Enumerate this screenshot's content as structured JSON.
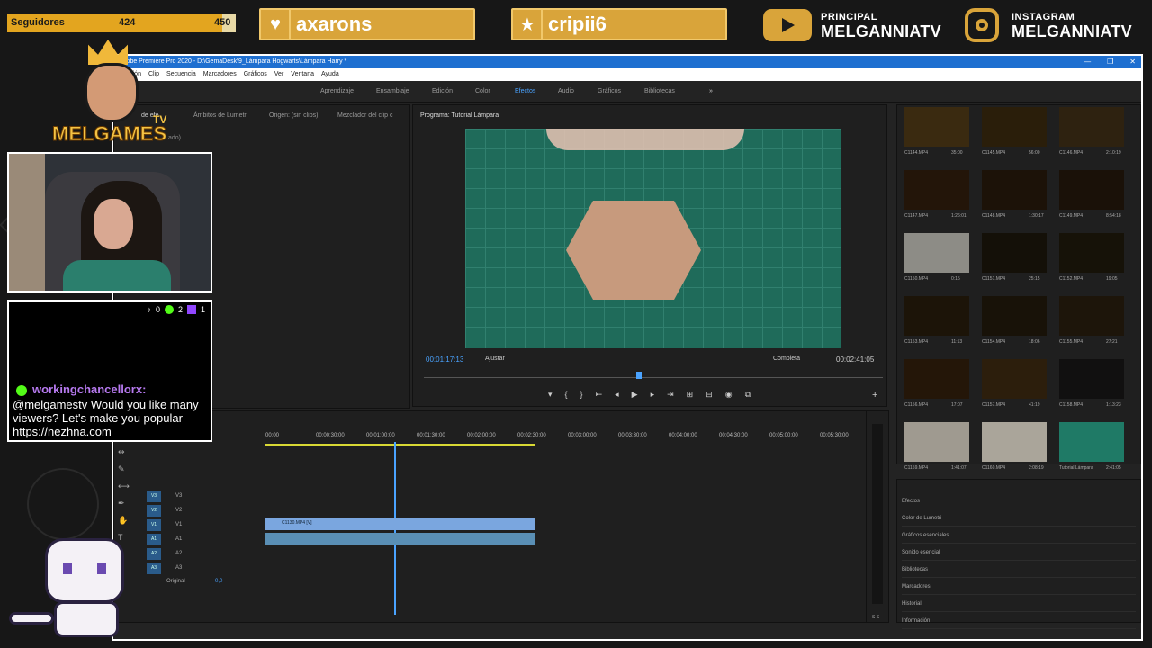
{
  "overlay": {
    "followers_label": "Seguidores",
    "followers_current": "424",
    "followers_goal": "450",
    "followers_progress": 0.942,
    "pill1": "axarons",
    "pill2": "cripii6",
    "youtube_label": "PRINCIPAL",
    "youtube_name": "MELGANNIATV",
    "instagram_label": "INSTAGRAM",
    "instagram_name": "MELGANNIATV",
    "logo_text": "MELGAMES",
    "logo_suffix": "TV"
  },
  "premiere": {
    "title": "Adobe Premiere Pro 2020 - D:\\GemaDesk\\9_Lámpara Hogwarts\\Lámpara Harry *",
    "menu": [
      "Edición",
      "Clip",
      "Secuencia",
      "Marcadores",
      "Gráficos",
      "Ver",
      "Ventana",
      "Ayuda"
    ],
    "workspaces": [
      "Aprendizaje",
      "Ensamblaje",
      "Edición",
      "Color",
      "Efectos",
      "Audio",
      "Gráficos",
      "Bibliotecas"
    ],
    "active_workspace": "Efectos",
    "source_tabs": [
      "Ámbitos de Lumetri",
      "Origen: (sin clips)",
      "Mezclador del clip c"
    ],
    "source_fragment_1": "de efe",
    "source_fragment_2": "ado)",
    "program_title": "Programa: Tutorial Lámpara",
    "timecode_current": "00:01:17:13",
    "fit": "Ajustar",
    "quality": "Completa",
    "timecode_total": "00:02:41:05",
    "ruler": [
      "00:00",
      "00:00:30:00",
      "00:01:00:00",
      "00:01:30:00",
      "00:02:00:00",
      "00:02:30:00",
      "00:03:00:00",
      "00:03:30:00",
      "00:04:00:00",
      "00:04:30:00",
      "00:05:00:00",
      "00:05:30:00"
    ],
    "tracks": [
      {
        "tag": "V3",
        "name": "V3"
      },
      {
        "tag": "V2",
        "name": "V2"
      },
      {
        "tag": "V1",
        "name": "V1"
      },
      {
        "tag": "A1",
        "name": "A1"
      },
      {
        "tag": "A2",
        "name": "A2"
      },
      {
        "tag": "A3",
        "name": "A3"
      }
    ],
    "clip_label": "C1130.MP4 [V]",
    "original_label": "Original",
    "original_value": "0,0",
    "meter_label": "S S",
    "clips": [
      {
        "name": "C1144.MP4",
        "dur": "35:00"
      },
      {
        "name": "C1145.MP4",
        "dur": "56:00"
      },
      {
        "name": "C1146.MP4",
        "dur": "2:10:19"
      },
      {
        "name": "C1147.MP4",
        "dur": "1:26:01"
      },
      {
        "name": "C1148.MP4",
        "dur": "1:30:17"
      },
      {
        "name": "C1149.MP4",
        "dur": "8:54:18"
      },
      {
        "name": "C1150.MP4",
        "dur": "0:15"
      },
      {
        "name": "C1151.MP4",
        "dur": "25:15"
      },
      {
        "name": "C1152.MP4",
        "dur": "19:05"
      },
      {
        "name": "C1153.MP4",
        "dur": "11:13"
      },
      {
        "name": "C1154.MP4",
        "dur": "18:06"
      },
      {
        "name": "C1155.MP4",
        "dur": "27:21"
      },
      {
        "name": "C1156.MP4",
        "dur": "17:07"
      },
      {
        "name": "C1157.MP4",
        "dur": "41:19"
      },
      {
        "name": "C1158.MP4",
        "dur": "1:13:23"
      },
      {
        "name": "C1159.MP4",
        "dur": "1:41:07"
      },
      {
        "name": "C1160.MP4",
        "dur": "2:08:19"
      },
      {
        "name": "Tutorial Lámpara",
        "dur": "2:41:05"
      }
    ],
    "right_panels": [
      "Efectos",
      "Color de Lumetri",
      "Gráficos esenciales",
      "Sonido esencial",
      "Bibliotecas",
      "Marcadores",
      "Historial",
      "Información"
    ]
  },
  "chat": {
    "tiktok_count": "0",
    "kick_count": "2",
    "twitch_count": "1",
    "username": "workingchancellorx:",
    "message": "@melgamestv Would you like many viewers? Let's make you popular — https://nezhna.com"
  }
}
